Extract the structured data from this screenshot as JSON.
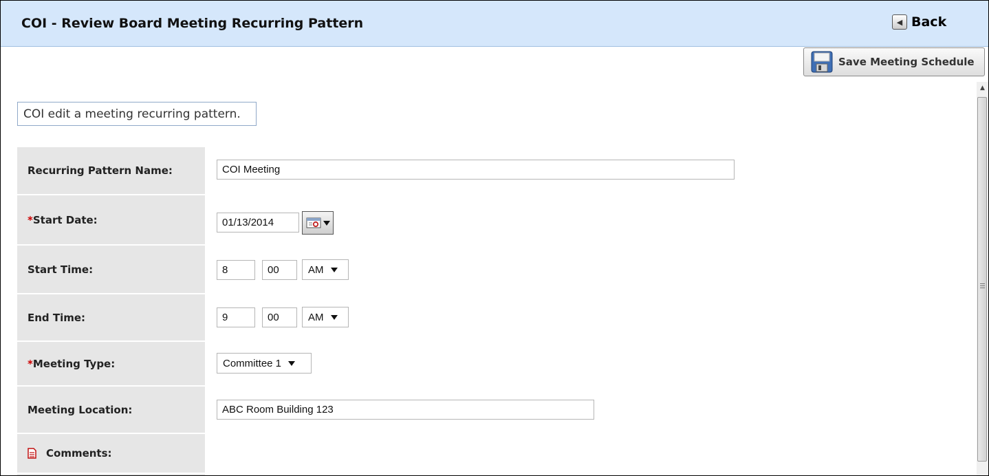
{
  "header": {
    "title": "COI - Review Board Meeting Recurring Pattern",
    "back_label": "Back"
  },
  "toolbar": {
    "save_label": "Save Meeting Schedule"
  },
  "description": "COI edit a meeting recurring pattern.",
  "form": {
    "pattern_name": {
      "label": "Recurring Pattern Name:",
      "value": "COI Meeting"
    },
    "start_date": {
      "required": "*",
      "label": "Start Date:",
      "value": "01/13/2014"
    },
    "start_time": {
      "label": "Start Time:",
      "hour": "8",
      "minute": "00",
      "ampm": "AM"
    },
    "end_time": {
      "label": "End Time:",
      "hour": "9",
      "minute": "00",
      "ampm": "AM"
    },
    "meeting_type": {
      "required": "*",
      "label": "Meeting Type:",
      "value": "Committee 1"
    },
    "meeting_location": {
      "label": "Meeting Location:",
      "value": "ABC Room Building 123"
    },
    "comments": {
      "label": "Comments:"
    }
  },
  "colors": {
    "header_bg": "#d5e7fb",
    "label_bg": "#e6e6e6",
    "required": "#cc0000"
  }
}
